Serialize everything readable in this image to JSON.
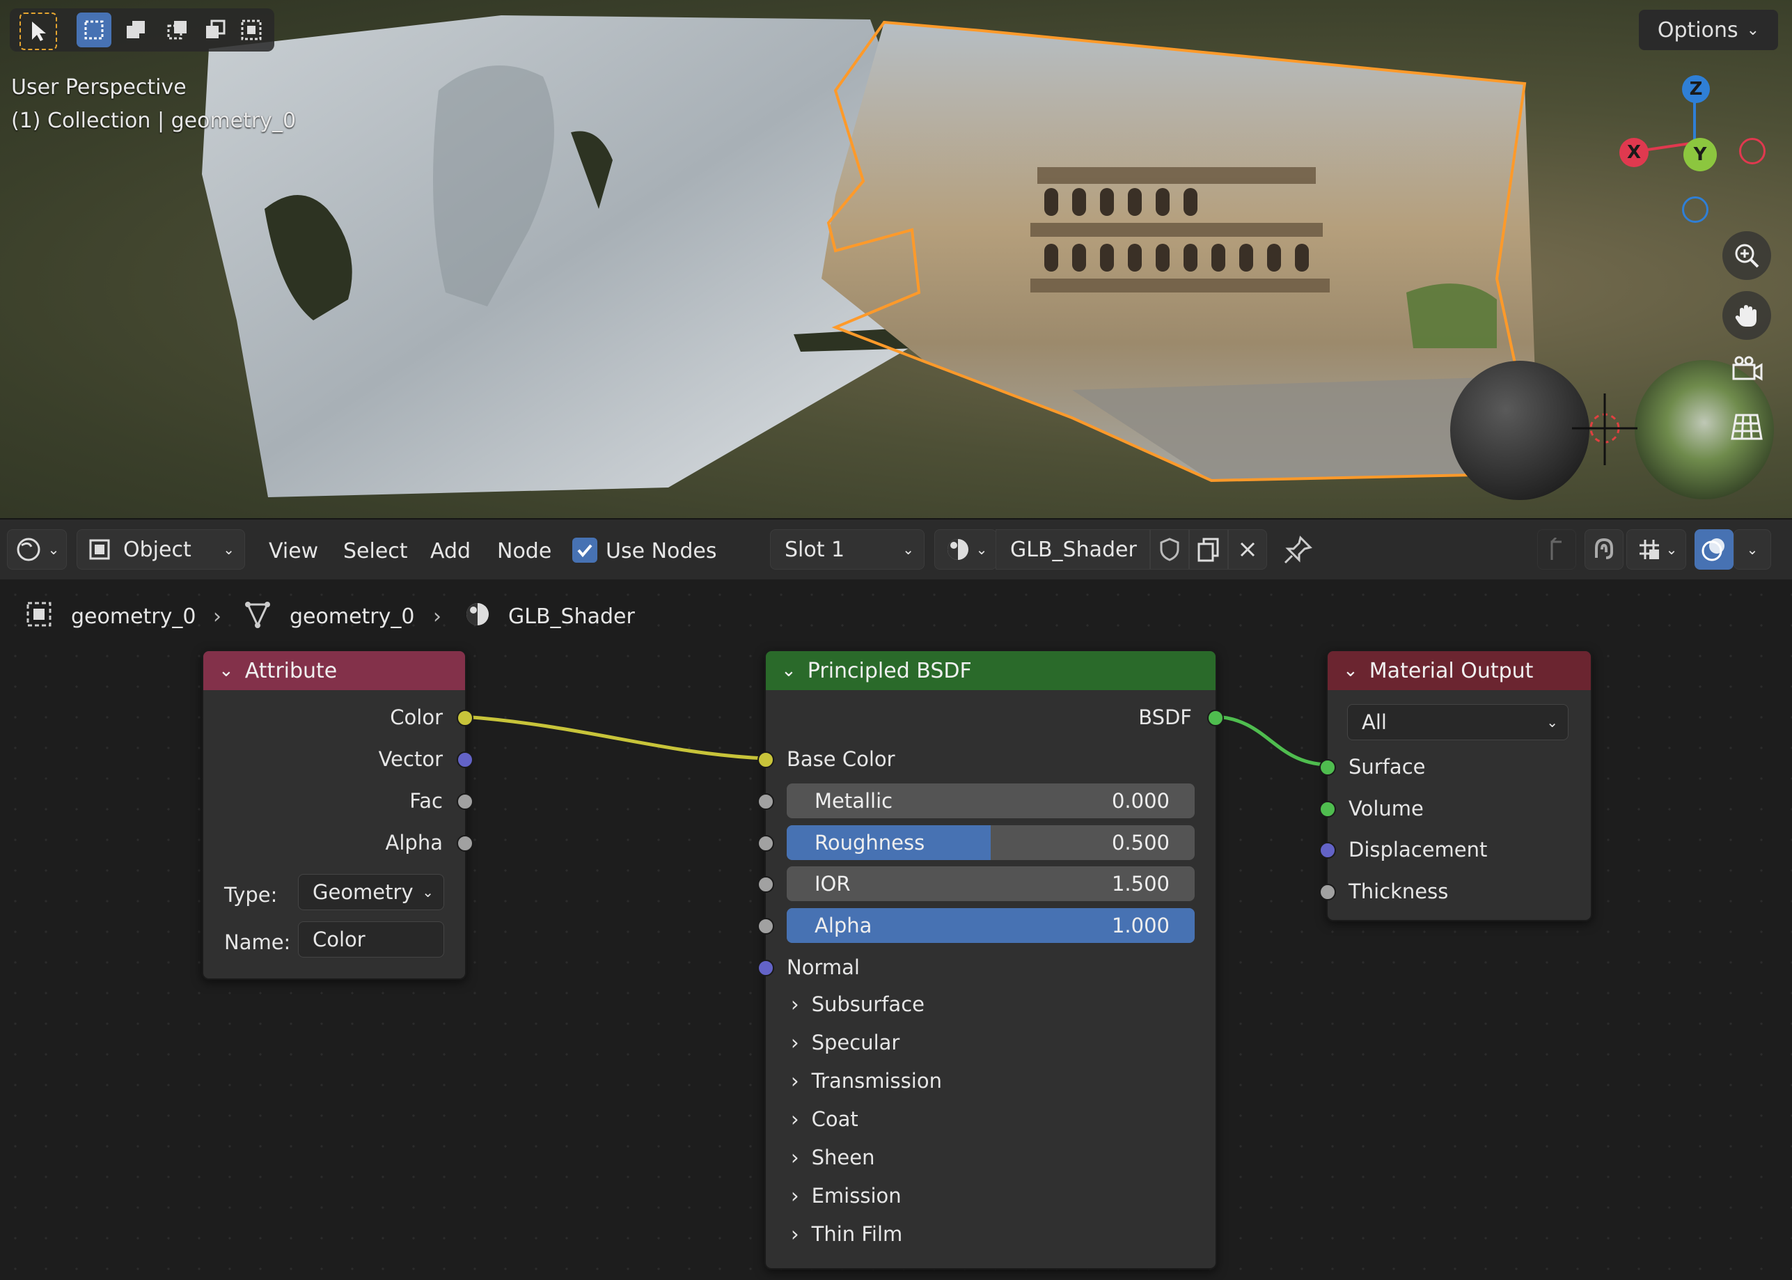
{
  "viewport": {
    "view_label": "User Perspective",
    "collection_label": "(1) Collection | geometry_0",
    "options_label": "Options",
    "gizmo": {
      "x": "X",
      "y": "Y",
      "z": "Z"
    },
    "colors": {
      "selection_outline": "#ff9a2a",
      "x_axis": "#e0394f",
      "y_axis": "#8cc63f",
      "z_axis": "#2f7fd6"
    }
  },
  "header": {
    "mode_label": "Object",
    "menus": [
      "View",
      "Select",
      "Add",
      "Node"
    ],
    "use_nodes_label": "Use Nodes",
    "use_nodes_checked": true,
    "slot_label": "Slot 1",
    "material_name": "GLB_Shader"
  },
  "breadcrumb": [
    "geometry_0",
    "geometry_0",
    "GLB_Shader"
  ],
  "nodes": {
    "attribute": {
      "title": "Attribute",
      "outputs": [
        "Color",
        "Vector",
        "Fac",
        "Alpha"
      ],
      "type_label": "Type:",
      "type_value": "Geometry",
      "name_label": "Name:",
      "name_value": "Color",
      "header_color": "#83314a"
    },
    "bsdf": {
      "title": "Principled BSDF",
      "output": "BSDF",
      "base_color_label": "Base Color",
      "fields": [
        {
          "label": "Metallic",
          "value": "0.000",
          "fill": 0.0
        },
        {
          "label": "Roughness",
          "value": "0.500",
          "fill": 0.5
        },
        {
          "label": "IOR",
          "value": "1.500",
          "fill": 0.0
        },
        {
          "label": "Alpha",
          "value": "1.000",
          "fill": 1.0
        }
      ],
      "normal_label": "Normal",
      "panels": [
        "Subsurface",
        "Specular",
        "Transmission",
        "Coat",
        "Sheen",
        "Emission",
        "Thin Film"
      ],
      "header_color": "#2a6a2a"
    },
    "output": {
      "title": "Material Output",
      "target": "All",
      "inputs": [
        "Surface",
        "Volume",
        "Displacement",
        "Thickness"
      ],
      "header_color": "#6b2530"
    }
  }
}
